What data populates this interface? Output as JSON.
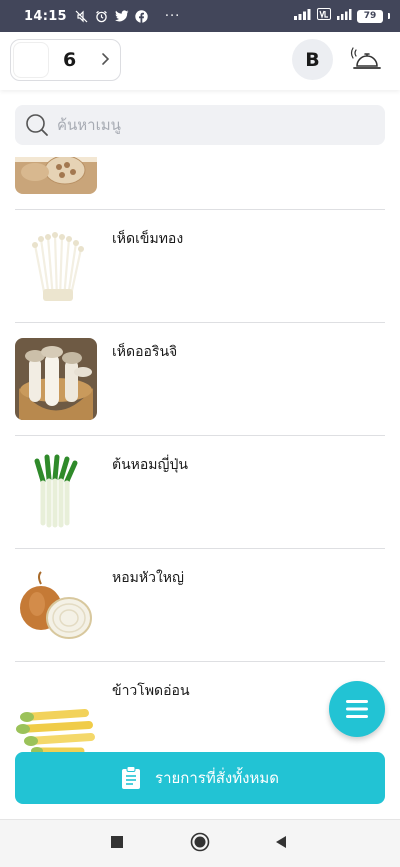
{
  "status_bar": {
    "time": "14:15",
    "dots": "···",
    "battery": "79",
    "icons": [
      "mute-icon",
      "alarm-icon",
      "twitter-icon",
      "facebook-icon",
      "signal-icon",
      "volte-icon",
      "signal-icon",
      "battery-icon"
    ]
  },
  "header": {
    "table_number": "6",
    "arrow": "›",
    "profile_initial": "B",
    "bell_icon": "service-bell-icon"
  },
  "search": {
    "placeholder": "ค้นหาเมนู"
  },
  "menu": {
    "items": [
      {
        "name": "",
        "image": "lotus-root"
      },
      {
        "name": "เห็ดเข็มทอง",
        "image": "enoki-mushroom"
      },
      {
        "name": "เห็ดออรินจิ",
        "image": "eryngii-mushroom"
      },
      {
        "name": "ต้นหอมญี่ปุ่น",
        "image": "japanese-leek"
      },
      {
        "name": "หอมหัวใหญ่",
        "image": "onion"
      },
      {
        "name": "ข้าวโพดอ่อน",
        "image": "baby-corn"
      }
    ]
  },
  "actions": {
    "orders_label": "รายการที่สั่งทั้งหมด",
    "fab_icon": "menu-icon"
  },
  "colors": {
    "accent": "#22c3d4",
    "status_bar": "#42465a",
    "search_bg": "#f0f1f4"
  }
}
